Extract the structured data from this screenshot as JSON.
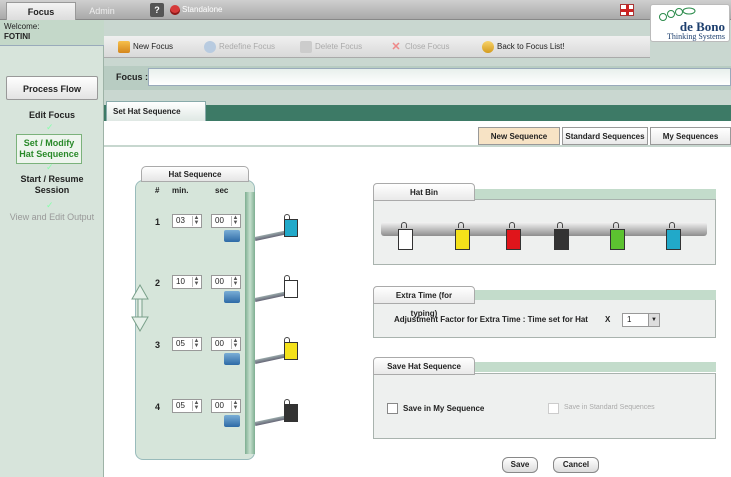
{
  "topbar": {
    "tabs": [
      {
        "label": "Focus"
      },
      {
        "label": "Admin"
      }
    ],
    "help_label": "?",
    "standalone_label": "Standalone"
  },
  "logo": {
    "brand": "de Bono",
    "tagline": "Thinking Systems"
  },
  "welcome": {
    "greeting": "Welcome:",
    "user": "FOTINI"
  },
  "leftnav": {
    "process_flow": "Process Flow",
    "edit_focus": "Edit Focus",
    "set_modify": "Set / Modify Hat Sequence",
    "start_resume": "Start / Resume Session",
    "view_edit": "View and Edit Output"
  },
  "toolbar": {
    "new_focus": "New Focus",
    "redefine_focus": "Redefine Focus",
    "delete_focus": "Delete Focus",
    "close_focus": "Close Focus",
    "back_to_list": "Back to Focus List!"
  },
  "focus": {
    "label": "Focus :",
    "value": ""
  },
  "section_tab": "Set Hat Sequence",
  "sequence_tabs": {
    "new": "New Sequence",
    "standard": "Standard Sequences",
    "my": "My Sequences"
  },
  "hat_sequence": {
    "title": "Hat Sequence",
    "headers": {
      "num": "#",
      "min": "min.",
      "sec": "sec"
    },
    "rows": [
      {
        "num": "1",
        "min": "03",
        "sec": "00",
        "hat_color": "#21a9c9"
      },
      {
        "num": "2",
        "min": "10",
        "sec": "00",
        "hat_color": "#ffffff"
      },
      {
        "num": "3",
        "min": "05",
        "sec": "00",
        "hat_color": "#f4e11a"
      },
      {
        "num": "4",
        "min": "05",
        "sec": "00",
        "hat_color": "#333333"
      }
    ]
  },
  "hat_bin": {
    "title": "Hat Bin",
    "hats": [
      {
        "name": "white-hat",
        "color": "#ffffff"
      },
      {
        "name": "yellow-hat",
        "color": "#f4e11a"
      },
      {
        "name": "red-hat",
        "color": "#e0151b"
      },
      {
        "name": "black-hat",
        "color": "#333333"
      },
      {
        "name": "green-hat",
        "color": "#5cc230"
      },
      {
        "name": "blue-hat",
        "color": "#21a9c9"
      }
    ]
  },
  "extra_time": {
    "title": "Extra Time (for typing)",
    "label": "Adjustment Factor for Extra Time  : Time set for Hat",
    "multiplier": "X",
    "value": "1"
  },
  "save_sequence": {
    "title": "Save Hat Sequence",
    "my_label": "Save in My Sequence",
    "standard_label": "Save in Standard Sequences",
    "save_button": "Save",
    "cancel_button": "Cancel"
  }
}
